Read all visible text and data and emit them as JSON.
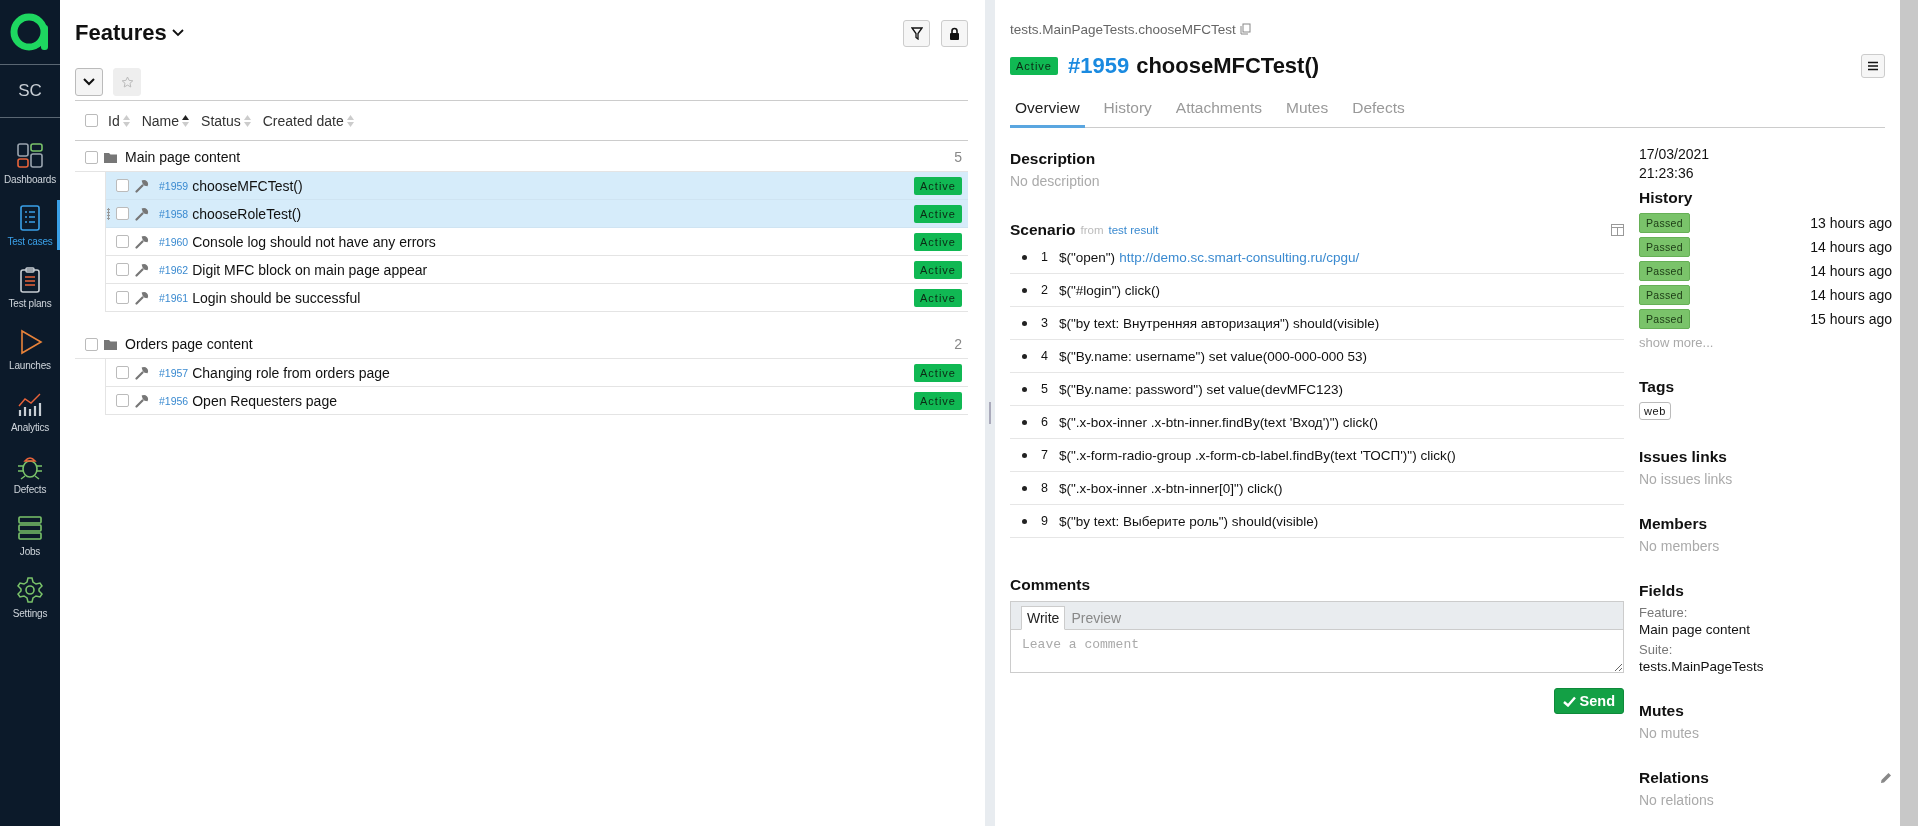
{
  "sidebar": {
    "workspace": "SC",
    "items": [
      {
        "label": "Dashboards",
        "kind": "dashboards",
        "selected": false
      },
      {
        "label": "Test cases",
        "kind": "testcases",
        "selected": true
      },
      {
        "label": "Test plans",
        "kind": "testplans",
        "selected": false
      },
      {
        "label": "Launches",
        "kind": "launches",
        "selected": false
      },
      {
        "label": "Analytics",
        "kind": "analytics",
        "selected": false
      },
      {
        "label": "Defects",
        "kind": "defects",
        "selected": false
      },
      {
        "label": "Jobs",
        "kind": "jobs",
        "selected": false
      },
      {
        "label": "Settings",
        "kind": "settings",
        "selected": false
      }
    ]
  },
  "features": {
    "title": "Features",
    "columns": [
      {
        "label": "Id",
        "sorted_ascending": false
      },
      {
        "label": "Name",
        "sorted_ascending": true
      },
      {
        "label": "Status",
        "sorted_ascending": false
      },
      {
        "label": "Created date",
        "sorted_ascending": false
      }
    ],
    "all_checked": false,
    "groups": [
      {
        "name": "Main page content",
        "count": "5",
        "checked": false,
        "cases": [
          {
            "id": "#1959",
            "name": "chooseMFCTest()",
            "status": "Active",
            "selected": true,
            "checked": false,
            "hovered": false
          },
          {
            "id": "#1958",
            "name": "chooseRoleTest()",
            "status": "Active",
            "selected": true,
            "checked": false,
            "hovered": true
          },
          {
            "id": "#1960",
            "name": "Console log should not have any errors",
            "status": "Active",
            "selected": false,
            "checked": false,
            "hovered": false
          },
          {
            "id": "#1962",
            "name": "Digit MFC block on main page appear",
            "status": "Active",
            "selected": false,
            "checked": false,
            "hovered": false
          },
          {
            "id": "#1961",
            "name": "Login should be successful",
            "status": "Active",
            "selected": false,
            "checked": false,
            "hovered": false
          }
        ]
      },
      {
        "name": "Orders page content",
        "count": "2",
        "checked": false,
        "cases": [
          {
            "id": "#1957",
            "name": "Changing role from orders page",
            "status": "Active",
            "selected": false,
            "checked": false,
            "hovered": false
          },
          {
            "id": "#1956",
            "name": "Open Requesters page",
            "status": "Active",
            "selected": false,
            "checked": false,
            "hovered": false
          }
        ]
      }
    ]
  },
  "detail": {
    "path": "tests.MainPageTests.chooseMFCTest",
    "status": "Active",
    "id": "#1959",
    "name": "chooseMFCTest()",
    "tabs": [
      {
        "label": "Overview",
        "selected": true
      },
      {
        "label": "History",
        "selected": false
      },
      {
        "label": "Attachments",
        "selected": false
      },
      {
        "label": "Mutes",
        "selected": false
      },
      {
        "label": "Defects",
        "selected": false
      }
    ],
    "description": {
      "title": "Description",
      "empty": "No description"
    },
    "scenario": {
      "title": "Scenario",
      "source_prefix": "from",
      "source_link": "test result",
      "steps": [
        {
          "number": "1",
          "text": "$(\"open\")",
          "link": "http://demo.sc.smart-consulting.ru/cpgu/"
        },
        {
          "number": "2",
          "text": "$(\"#login\") click()"
        },
        {
          "number": "3",
          "text": "$(\"by text: Внутренняя авторизация\") should(visible)"
        },
        {
          "number": "4",
          "text": "$(\"By.name: username\") set value(000-000-000 53)"
        },
        {
          "number": "5",
          "text": "$(\"By.name: password\") set value(devMFC123)"
        },
        {
          "number": "6",
          "text": "$(\".x-box-inner .x-btn-inner.findBy(text 'Вход')\") click()"
        },
        {
          "number": "7",
          "text": "$(\".x-form-radio-group .x-form-cb-label.findBy(text 'ТОСП')\") click()"
        },
        {
          "number": "8",
          "text": "$(\".x-box-inner .x-btn-inner[0]\") click()"
        },
        {
          "number": "9",
          "text": "$(\"by text: Выберите роль\") should(visible)"
        }
      ]
    },
    "comments": {
      "title": "Comments",
      "tabs": [
        {
          "label": "Write",
          "selected": true
        },
        {
          "label": "Preview",
          "selected": false
        }
      ],
      "placeholder": "Leave a comment",
      "send": "Send"
    }
  },
  "info": {
    "created_date": "17/03/2021",
    "created_time": "21:23:36",
    "history": {
      "title": "History",
      "runs": [
        {
          "status": "Passed",
          "time": "13 hours ago"
        },
        {
          "status": "Passed",
          "time": "14 hours ago"
        },
        {
          "status": "Passed",
          "time": "14 hours ago"
        },
        {
          "status": "Passed",
          "time": "14 hours ago"
        },
        {
          "status": "Passed",
          "time": "15 hours ago"
        }
      ],
      "more": "show more..."
    },
    "tags": {
      "title": "Tags",
      "items": [
        "web"
      ]
    },
    "issues": {
      "title": "Issues links",
      "empty": "No issues links"
    },
    "members": {
      "title": "Members",
      "empty": "No members"
    },
    "fields": {
      "title": "Fields",
      "items": [
        {
          "label": "Feature:",
          "value": "Main page content"
        },
        {
          "label": "Suite:",
          "value": "tests.MainPageTests"
        }
      ]
    },
    "mutes": {
      "title": "Mutes",
      "empty": "No mutes"
    },
    "relations": {
      "title": "Relations",
      "empty": "No relations"
    }
  }
}
